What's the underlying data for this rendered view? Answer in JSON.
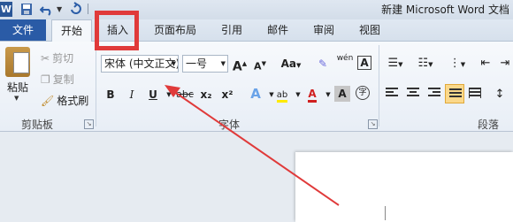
{
  "titlebar": {
    "app_logo": "W",
    "doc_title": "新建 Microsoft Word 文档"
  },
  "tabs": [
    "文件",
    "开始",
    "插入",
    "页面布局",
    "引用",
    "邮件",
    "审阅",
    "视图"
  ],
  "clipboard": {
    "paste": "粘贴",
    "cut": "剪切",
    "copy": "复制",
    "format_painter": "格式刷",
    "group_label": "剪贴板"
  },
  "font": {
    "font_name": "宋体 (中文正文)",
    "font_size": "一号",
    "grow": "A",
    "shrink": "A",
    "change_case": "Aa",
    "phonetic": "wén",
    "border_char": "A",
    "bold": "B",
    "italic": "I",
    "underline": "U",
    "strikethrough": "abc",
    "subscript": "x₂",
    "superscript": "x²",
    "text_effect": "A",
    "highlight": "ab",
    "font_color": "A",
    "char_shading": "A",
    "enclose": "字",
    "group_label": "字体"
  },
  "paragraph": {
    "group_label": "段落"
  },
  "colors": {
    "file_tab": "#2a5ba6",
    "highlight_box": "#e03a3a",
    "arrow": "#e03a3a"
  }
}
